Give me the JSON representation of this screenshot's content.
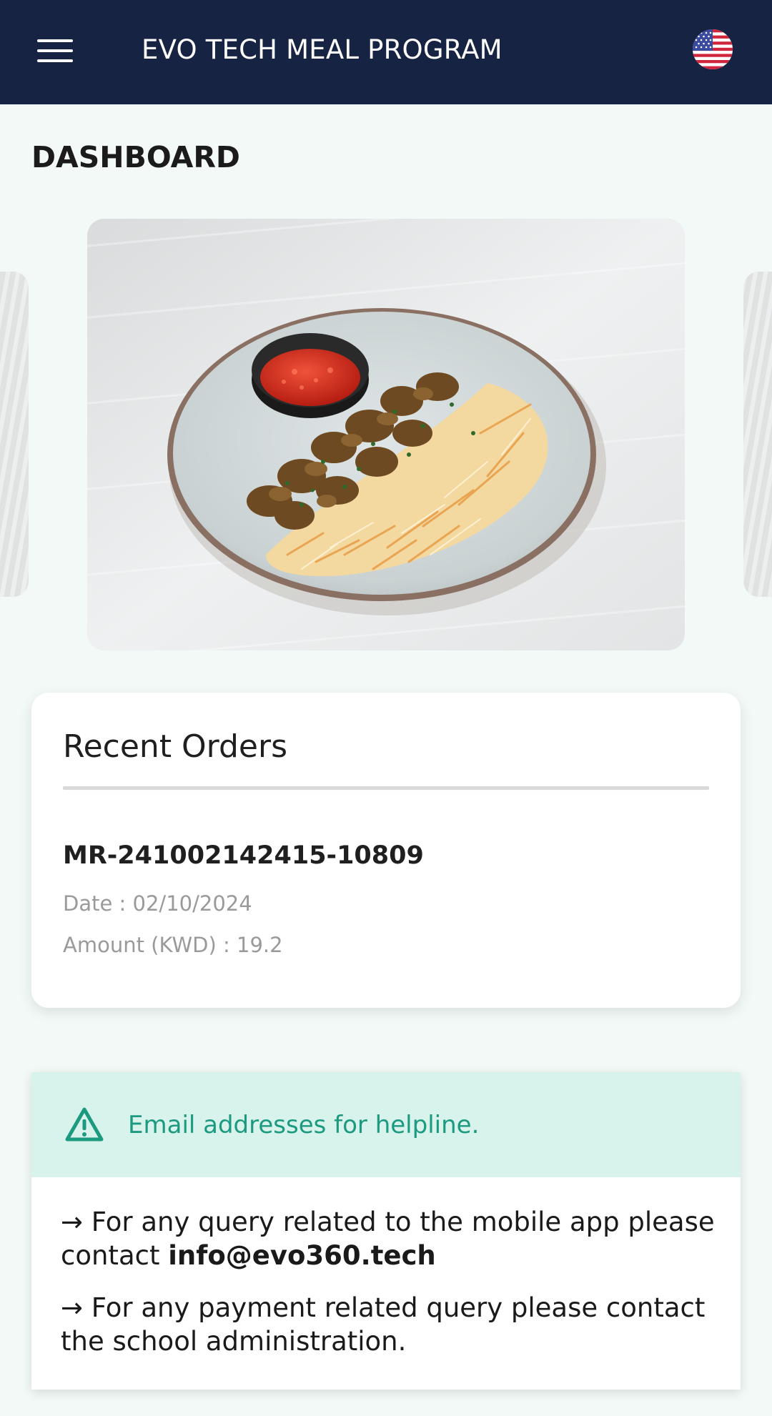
{
  "header": {
    "title": "EVO TECH MEAL PROGRAM",
    "menu_icon": "hamburger-menu-icon",
    "language_icon": "us-flag-icon"
  },
  "page": {
    "title": "DASHBOARD"
  },
  "recent_orders": {
    "title": "Recent Orders",
    "orders": [
      {
        "id": "MR-241002142415-10809",
        "date_label": "Date : 02/10/2024",
        "amount_label": "Amount (KWD) : 19.2"
      }
    ]
  },
  "helpline": {
    "icon": "warning-icon",
    "heading": "Email addresses for helpline.",
    "line1_prefix": "→ For any query related to the mobile app please contact ",
    "line1_email": "info@evo360.tech",
    "line2": "→ For any payment related query please contact the school administration."
  },
  "colors": {
    "app_bar": "#172342",
    "page_background": "#f2f9f6",
    "help_header_background": "#d8f2ec",
    "help_accent": "#1c9a80"
  }
}
